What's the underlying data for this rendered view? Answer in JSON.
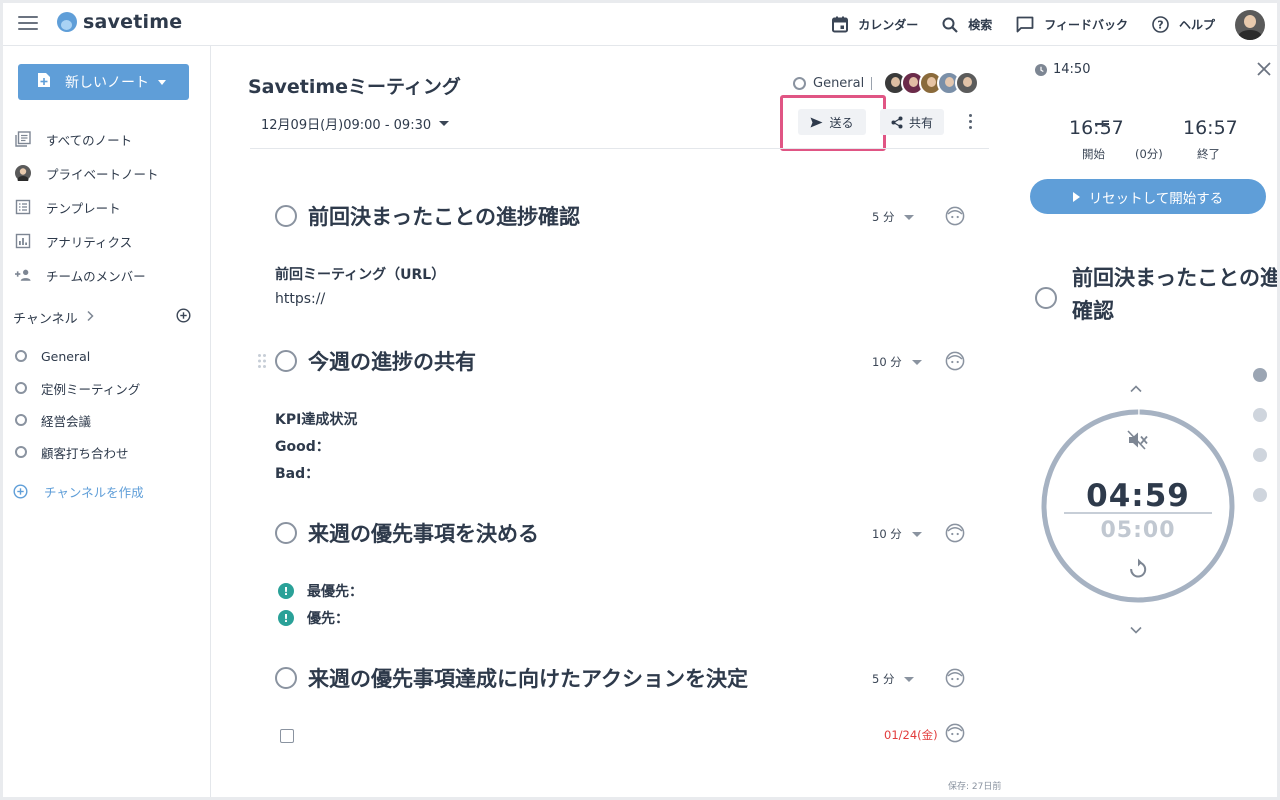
{
  "app": {
    "name": "savetime"
  },
  "topnav": {
    "calendar": "カレンダー",
    "search": "検索",
    "feedback": "フィードバック",
    "help": "ヘルプ"
  },
  "sidebar": {
    "new_note": "新しいノート",
    "items": [
      {
        "label": "すべてのノート",
        "icon": "notes-icon"
      },
      {
        "label": "プライベートノート",
        "icon": "user-avatar-icon"
      },
      {
        "label": "テンプレート",
        "icon": "template-icon"
      },
      {
        "label": "アナリティクス",
        "icon": "analytics-icon"
      },
      {
        "label": "チームのメンバー",
        "icon": "add-member-icon"
      }
    ],
    "channels_heading": "チャンネル",
    "channels": [
      "General",
      "定例ミーティング",
      "経営会議",
      "顧客打ち合わせ"
    ],
    "create_channel": "チャンネルを作成"
  },
  "note": {
    "title": "Savetimeミーティング",
    "datetime": "12月09日(月)09:00 - 09:30",
    "channel": "General",
    "send": "送る",
    "share": "共有",
    "saved": "保存: 27日前",
    "agenda": [
      {
        "title": "前回決まったことの進捗確認",
        "duration": "5 分"
      },
      {
        "title": "今週の進捗の共有",
        "duration": "10 分"
      },
      {
        "title": "来週の優先事項を決める",
        "duration": "10 分"
      },
      {
        "title": "来週の優先事項達成に向けたアクションを決定",
        "duration": "5 分"
      }
    ],
    "content": {
      "prev_meeting_label": "前回ミーティング（URL）",
      "prev_meeting_url": "https://",
      "kpi": "KPI達成状況",
      "good": "Good：",
      "bad": "Bad：",
      "top_priority": "最優先：",
      "priority": "優先：",
      "task_due": "01/24(金)"
    }
  },
  "timer": {
    "clock": "14:50",
    "start_time": "16:57",
    "start_label": "開始",
    "end_time": "16:57",
    "end_label": "終了",
    "elapsed": "(0分)",
    "reset_button": "リセットして開始する",
    "current_agenda": "前回決まったことの進捗確認",
    "remaining": "04:59",
    "total": "05:00",
    "progress_fraction": 0.997
  },
  "colors": {
    "accent": "#5f9ed8",
    "highlight": "#e05584",
    "priority_badge": "#2aa198",
    "due_date": "#e23b3b"
  }
}
